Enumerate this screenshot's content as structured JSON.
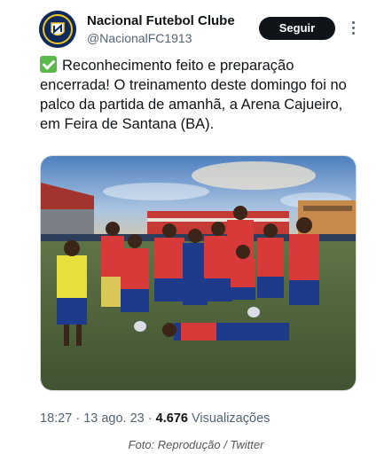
{
  "account": {
    "display_name": "Nacional Futebol Clube",
    "handle": "@NacionalFC1913",
    "avatar_icon": "club-crest-icon"
  },
  "actions": {
    "follow_label": "Seguir",
    "more_icon": "more-vertical-icon"
  },
  "tweet": {
    "text": "Reconhecimento feito e preparação encerrada! O treinamento deste domingo foi no palco da partida de amanhã, a Arena Cajueiro, em Feira de Santana (BA).",
    "leading_emoji_icon": "check-mark-button-icon"
  },
  "media": {
    "alt_icon": "team-photo-image"
  },
  "meta": {
    "time": "18:27",
    "separator": "·",
    "date": "13 ago. 23",
    "views_count": "4.676",
    "views_label": "Visualizações"
  },
  "caption": "Foto: Reprodução / Twitter",
  "colors": {
    "text_primary": "#0f1419",
    "text_secondary": "#536471",
    "follow_bg": "#0f1419",
    "check_green": "#5ab94a",
    "club_navy": "#0e2a5c"
  }
}
